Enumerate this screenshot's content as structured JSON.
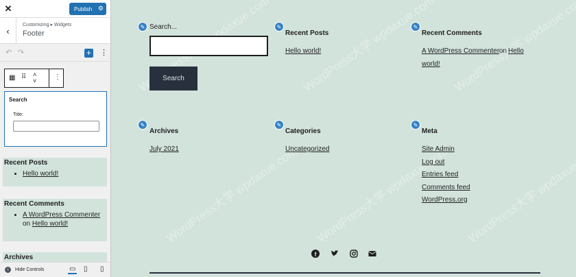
{
  "customizer": {
    "close_glyph": "✕",
    "publish_label": "Publish",
    "breadcrumb": "Customizing ▸ Widgets",
    "section_title": "Footer",
    "search_block": {
      "label": "Search",
      "title_label": "Title:",
      "title_value": ""
    },
    "recent_posts": {
      "heading": "Recent Posts",
      "items": [
        "Hello world!"
      ]
    },
    "recent_comments": {
      "heading": "Recent Comments",
      "author": "A WordPress Commenter",
      "on": "on",
      "post": "Hello world!"
    },
    "archives": {
      "heading": "Archives"
    },
    "hide_controls_label": "Hide Controls"
  },
  "preview": {
    "search": {
      "title": "Search...",
      "input_value": "",
      "button_label": "Search"
    },
    "recent_posts": {
      "title": "Recent Posts",
      "items": [
        "Hello world!"
      ]
    },
    "recent_comments": {
      "title": "Recent Comments",
      "author": "A WordPress Commenter",
      "on": "on",
      "post_line1": "Hello",
      "post_line2": "world!"
    },
    "archives": {
      "title": "Archives",
      "items": [
        "July 2021"
      ]
    },
    "categories": {
      "title": "Categories",
      "items": [
        "Uncategorized"
      ]
    },
    "meta": {
      "title": "Meta",
      "items": [
        "Site Admin",
        "Log out",
        "Entries feed",
        "Comments feed",
        "WordPress.org"
      ]
    },
    "social_icons": [
      "facebook-icon",
      "twitter-icon",
      "instagram-icon",
      "email-icon"
    ]
  },
  "watermark": "WordPress大学 wpdaxue.com",
  "colors": {
    "accent": "#2271b1",
    "preview_bg": "#d2e3dc",
    "button_bg": "#28303d"
  }
}
